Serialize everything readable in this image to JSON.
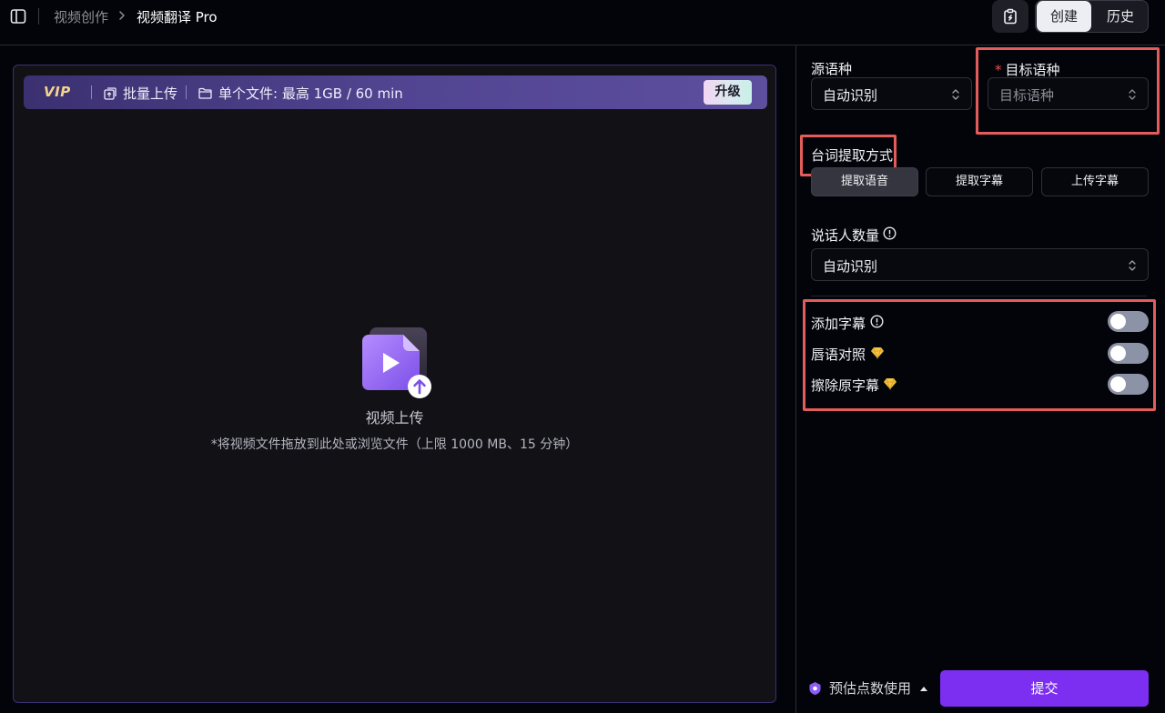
{
  "header": {
    "breadcrumb_parent": "视频创作",
    "breadcrumb_current": "视频翻译 Pro",
    "tabs": [
      {
        "label": "创建",
        "active": true
      },
      {
        "label": "历史",
        "active": false
      }
    ]
  },
  "upload": {
    "vip_badge": "VIP",
    "batch_upload": "批量上传",
    "file_limit": "单个文件: 最高 1GB / 60 min",
    "upgrade": "升级",
    "title": "视频上传",
    "hint": "*将视频文件拖放到此处或浏览文件（上限 1000 MB、15 分钟）"
  },
  "settings": {
    "source_language": {
      "label": "源语种",
      "value": "自动识别"
    },
    "target_language": {
      "required_mark": "*",
      "label": "目标语种",
      "placeholder": "目标语种"
    },
    "extraction": {
      "label": "台词提取方式",
      "options": [
        {
          "label": "提取语音",
          "selected": true
        },
        {
          "label": "提取字幕",
          "selected": false
        },
        {
          "label": "上传字幕",
          "selected": false
        }
      ]
    },
    "speakers": {
      "label": "说话人数量",
      "value": "自动识别"
    },
    "toggles": [
      {
        "label": "添加字幕",
        "on": false,
        "icon": "info-icon"
      },
      {
        "label": "唇语对照",
        "on": false,
        "icon": "gem-icon"
      },
      {
        "label": "擦除原字幕",
        "on": false,
        "icon": "gem-icon"
      }
    ]
  },
  "footer": {
    "estimate_label": "预估点数使用",
    "submit": "提交"
  },
  "colors": {
    "accent": "#7c2ff0",
    "highlight": "#e45b5b",
    "required": "#ef4f4f",
    "vip_gold": "#f2d58c"
  }
}
